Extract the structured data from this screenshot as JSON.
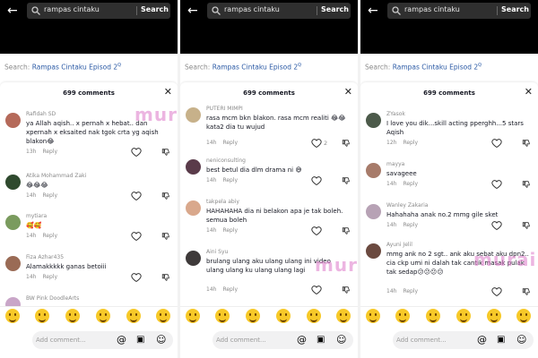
{
  "search": {
    "query": "rampas cintaku",
    "button": "Search"
  },
  "related": {
    "prefix": "Search: ",
    "term": "Rampas Cintaku Episod 2"
  },
  "sheet": {
    "count": "699 comments",
    "placeholder": "Add comment..."
  },
  "watermark": "murai",
  "reply_label": "Reply",
  "colors": {
    "link": "#2b5aa5",
    "topbar": "#000000",
    "muted": "#8a8a8a",
    "emoji": "#f7c928"
  },
  "icons": [
    "back-arrow-icon",
    "search-icon",
    "close-icon",
    "heart-icon",
    "dislike-icon",
    "mention-icon",
    "gift-icon",
    "emoji-icon"
  ],
  "panes": [
    {
      "comments": [
        {
          "user": "Rafidah SD",
          "text": "ya Allah aqish.. x pernah x hebat.. dan xpernah x eksaited nak tgok crta yg aqish blakon😂",
          "time": "13h",
          "likes": ""
        },
        {
          "user": "Atika Mohammad Zaki",
          "text": "😂😂😂",
          "time": "14h",
          "likes": ""
        },
        {
          "user": "mytiara",
          "text": "🥰🥰",
          "time": "14h",
          "likes": ""
        },
        {
          "user": "Fiza Azhar435",
          "text": "Alamakkkkk ganas betoiii",
          "time": "14h",
          "likes": ""
        },
        {
          "user": "BW Pink DoodleArts",
          "text": "",
          "time": "",
          "likes": ""
        }
      ]
    },
    {
      "comments": [
        {
          "user": "PUTERI MIMPI",
          "text": "rasa mcm bkn blakon. rasa mcm realiti 😂😂 kata2 dia tu wujud",
          "time": "14h",
          "likes": "2"
        },
        {
          "user": "neniconsulting",
          "text": "best betul dia dlm drama ni 😅",
          "time": "14h",
          "likes": ""
        },
        {
          "user": "takpela abiy",
          "text": "HAHAHAHA dia ni belakon apa je tak boleh. semua boleh",
          "time": "14h",
          "likes": ""
        },
        {
          "user": "Aini Syu",
          "text": "brulang ulang aku ulang ulang ini video ulang ulang ku ulang ulang lagi",
          "time": "14h",
          "likes": ""
        }
      ]
    },
    {
      "comments": [
        {
          "user": "ZYasok",
          "text": "I love you dik...skill acting pperghh...5 stars Aqish",
          "time": "12h",
          "likes": ""
        },
        {
          "user": "mayya",
          "text": "savageee",
          "time": "14h",
          "likes": ""
        },
        {
          "user": "Wanley Zakaria",
          "text": "Hahahaha anak no.2 mmg gile sket",
          "time": "14h",
          "likes": ""
        },
        {
          "user": "Ayuni Jelil",
          "text": "mmg ank no 2 sgt.. ank aku sebat aku dpn2.. cia ckp umi ni dalah tak cantik masak pulak tak sedap😕😕😕😕",
          "time": "14h",
          "likes": ""
        }
      ]
    }
  ]
}
